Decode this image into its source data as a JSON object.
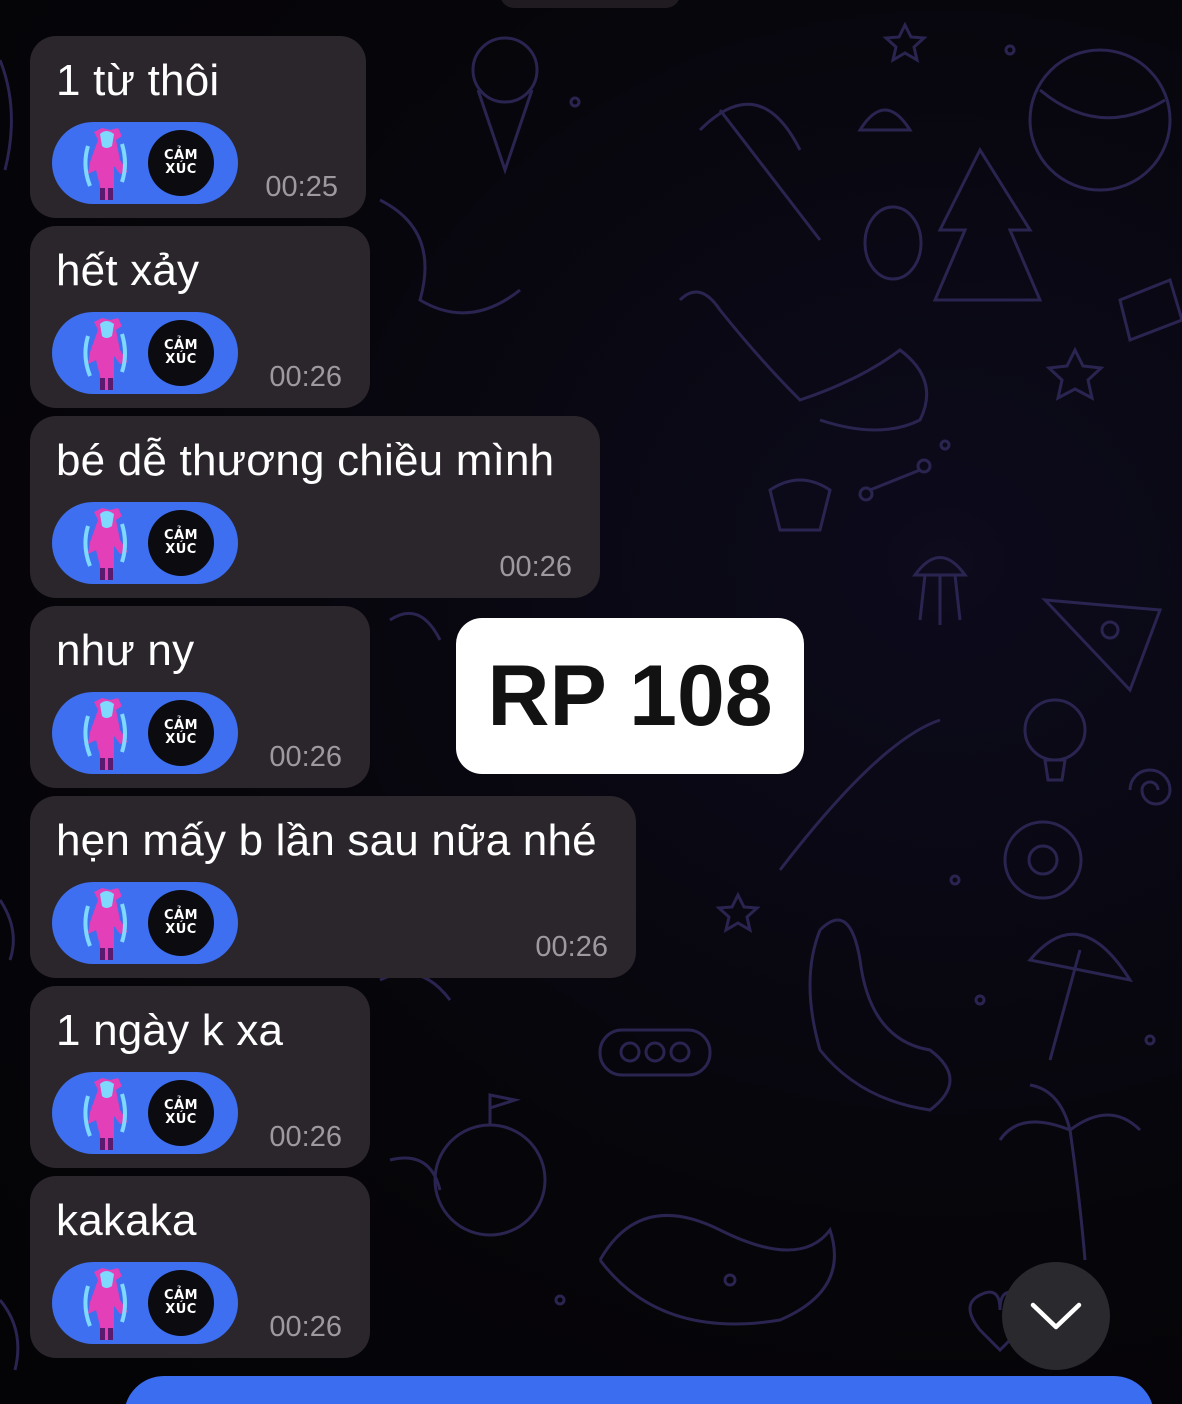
{
  "chat": {
    "messages": [
      {
        "text": "1 từ thôi",
        "time": "00:25"
      },
      {
        "text": "hết xảy",
        "time": "00:26"
      },
      {
        "text": "bé dễ thương chiều mình",
        "time": "00:26"
      },
      {
        "text": "như ny",
        "time": "00:26"
      },
      {
        "text": "hẹn mấy b lần sau nữa nhé",
        "time": "00:26"
      },
      {
        "text": "1 ngày k xa",
        "time": "00:26"
      },
      {
        "text": "kakaka",
        "time": "00:26"
      }
    ],
    "sticker_badge": {
      "line1": "CẢM",
      "line2": "XÚC"
    }
  },
  "overlay": {
    "label": "RP 108"
  },
  "icons": {
    "scroll_down": "chevron-down-icon",
    "sticker_art": "anime-girl-icon"
  },
  "colors": {
    "bubble": "#2b252c",
    "sticker": "#3d6ff0",
    "input_bar": "#3a6df0",
    "timestamp": "#9e989f"
  }
}
